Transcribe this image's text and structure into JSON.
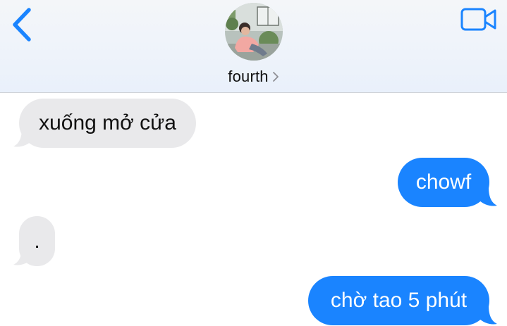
{
  "header": {
    "contact_name": "fourth",
    "back_icon": "chevron-left-icon",
    "video_icon": "video-camera-icon",
    "detail_icon": "chevron-right-icon",
    "accent_color": "#1a84ff"
  },
  "messages": [
    {
      "direction": "incoming",
      "text": "xuống mở cửa"
    },
    {
      "direction": "outgoing",
      "text": "chowf"
    },
    {
      "direction": "incoming",
      "text": "."
    },
    {
      "direction": "outgoing",
      "text": "chờ tao 5 phút"
    }
  ],
  "colors": {
    "incoming_bubble": "#e9e9eb",
    "outgoing_bubble": "#1a84ff",
    "header_background": "#eef3fa"
  }
}
